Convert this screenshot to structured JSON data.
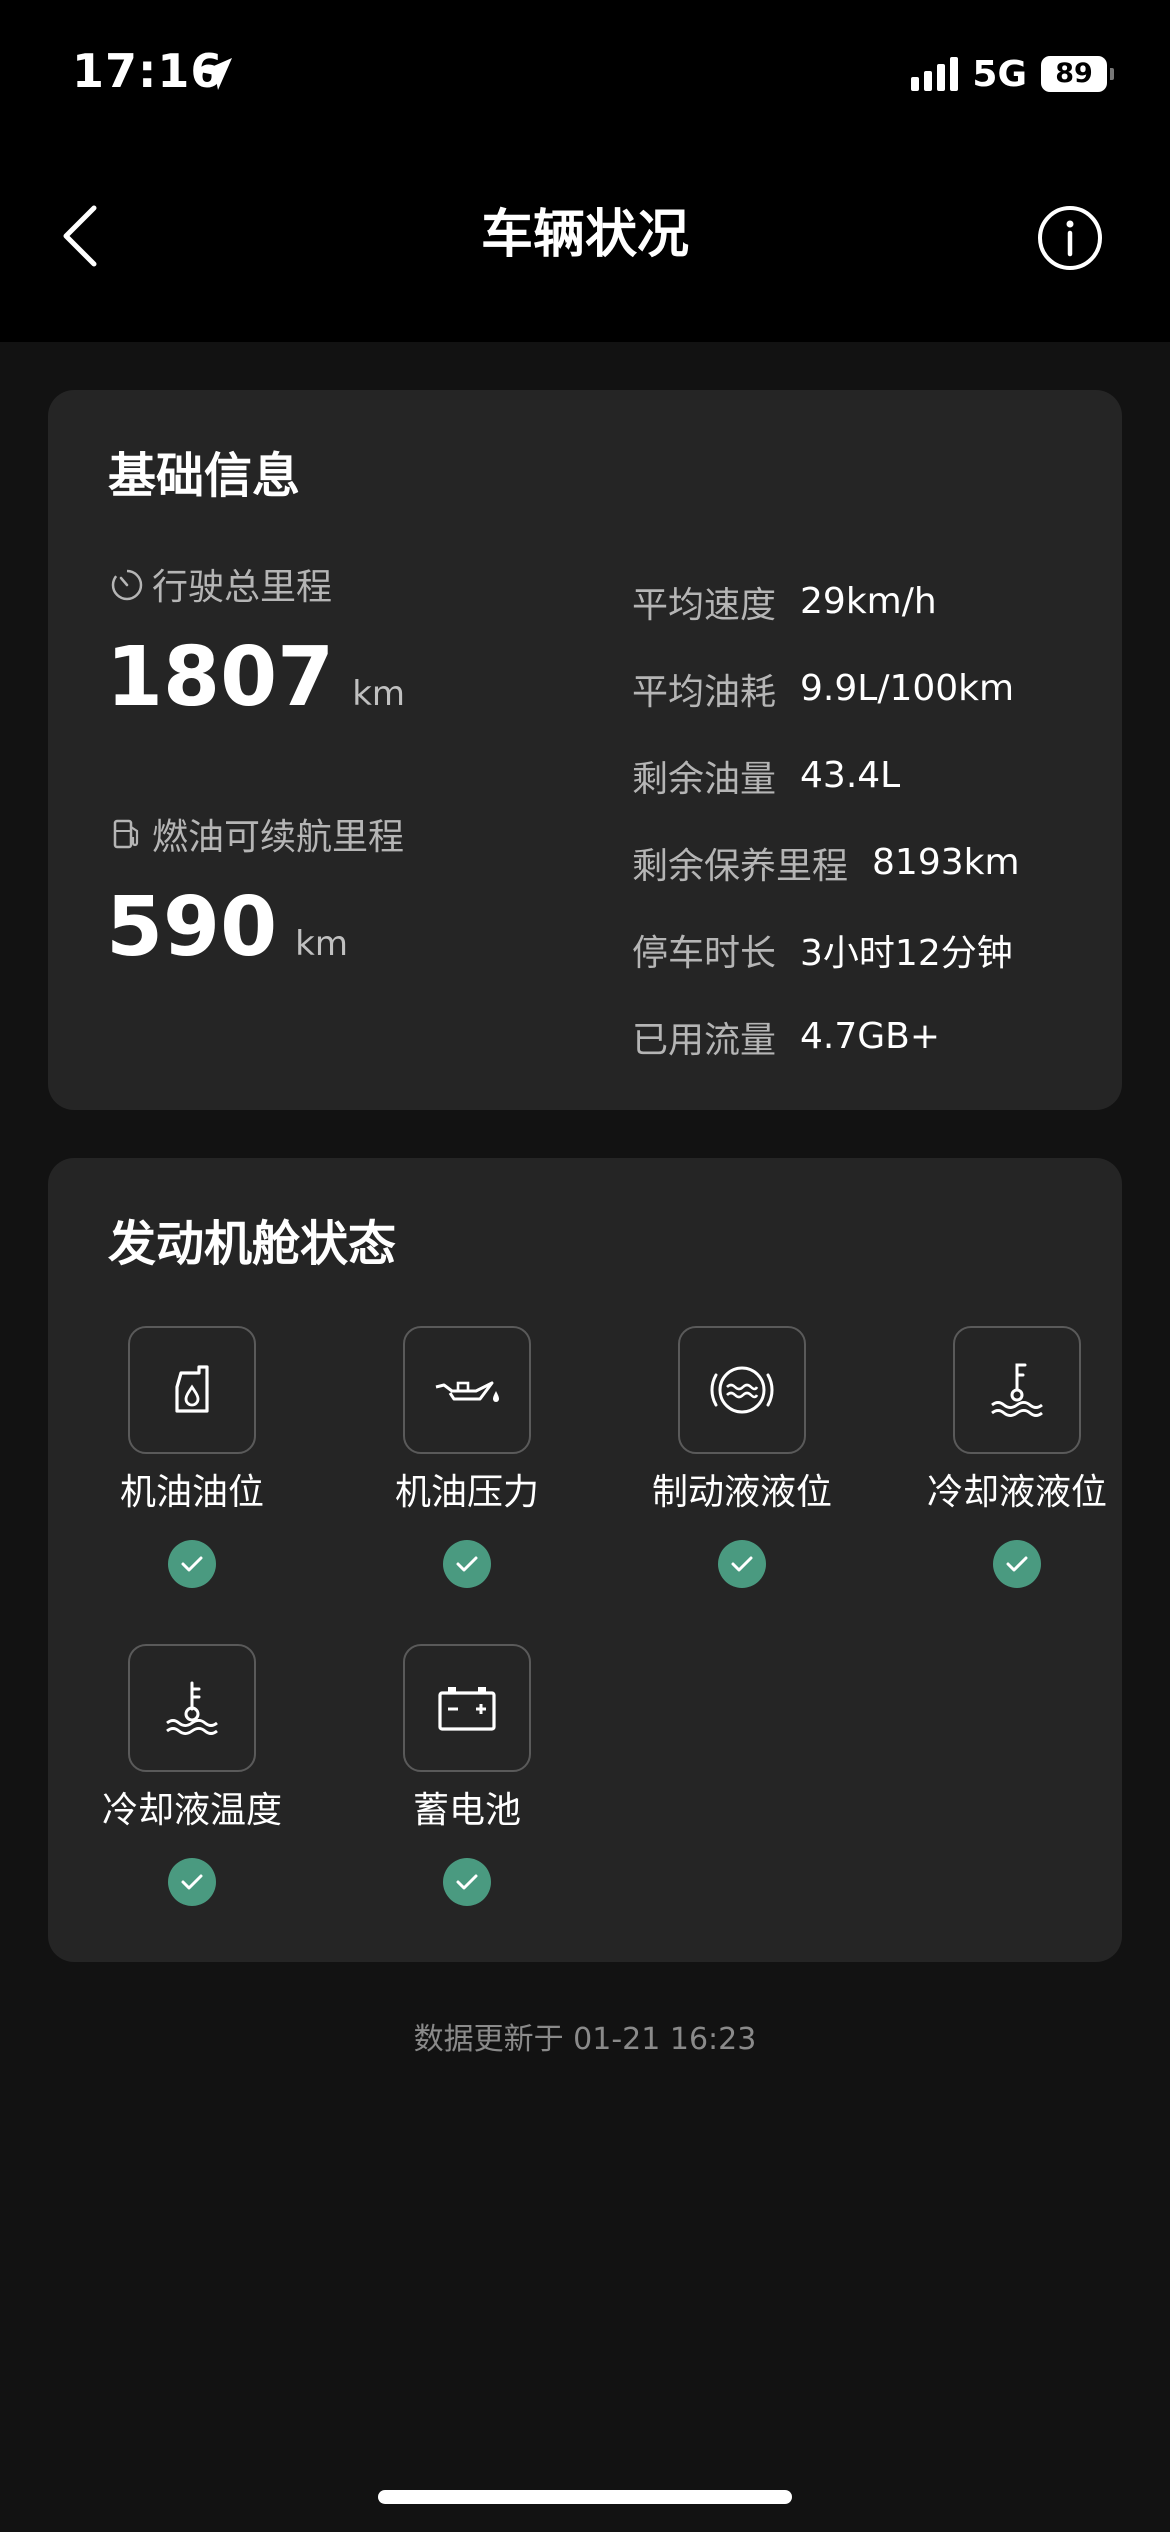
{
  "status_bar": {
    "time": "17:16",
    "network": "5G",
    "battery": "89"
  },
  "header": {
    "title": "车辆状况"
  },
  "basic_info": {
    "title": "基础信息",
    "odometer": {
      "label": "行驶总里程",
      "value": "1807",
      "unit": "km"
    },
    "range": {
      "label": "燃油可续航里程",
      "value": "590",
      "unit": "km"
    },
    "stats": [
      {
        "label": "平均速度",
        "value": "29km/h"
      },
      {
        "label": "平均油耗",
        "value": "9.9L/100km"
      },
      {
        "label": "剩余油量",
        "value": "43.4L"
      },
      {
        "label": "剩余保养里程",
        "value": "8193km"
      },
      {
        "label": "停车时长",
        "value": "3小时12分钟"
      },
      {
        "label": "已用流量",
        "value": "4.7GB+"
      }
    ]
  },
  "engine": {
    "title": "发动机舱状态",
    "items": [
      {
        "label": "机油油位",
        "icon": "oil-level-icon",
        "status": "ok"
      },
      {
        "label": "机油压力",
        "icon": "oil-pressure-icon",
        "status": "ok"
      },
      {
        "label": "制动液液位",
        "icon": "brake-fluid-icon",
        "status": "ok"
      },
      {
        "label": "冷却液液位",
        "icon": "coolant-level-icon",
        "status": "ok"
      },
      {
        "label": "冷却液温度",
        "icon": "coolant-temperature-icon",
        "status": "ok"
      },
      {
        "label": "蓄电池",
        "icon": "battery-icon",
        "status": "ok"
      }
    ]
  },
  "footer": {
    "update_text": "数据更新于 01-21 16:23"
  },
  "colors": {
    "background": "#121212",
    "card": "#252525",
    "status_ok": "#4a9a80"
  }
}
